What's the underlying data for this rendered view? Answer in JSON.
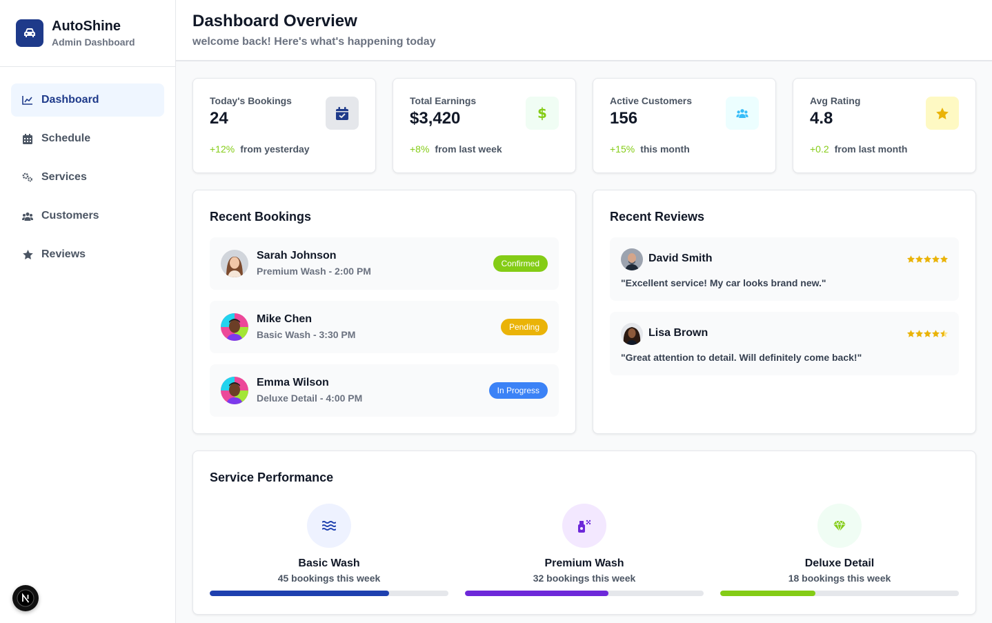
{
  "brand": {
    "name": "AutoShine",
    "subtitle": "Admin Dashboard"
  },
  "nav": [
    {
      "label": "Dashboard",
      "icon": "chart-line-icon",
      "active": true
    },
    {
      "label": "Schedule",
      "icon": "calendar-icon"
    },
    {
      "label": "Services",
      "icon": "gears-icon"
    },
    {
      "label": "Customers",
      "icon": "users-icon"
    },
    {
      "label": "Reviews",
      "icon": "star-icon"
    }
  ],
  "header": {
    "title": "Dashboard Overview",
    "subtitle": "welcome back! Here's what's happening today"
  },
  "stats": [
    {
      "label": "Today's Bookings",
      "value": "24",
      "delta": "+12%",
      "period": "from yesterday",
      "icon": "calendar-check-icon",
      "icon_color": "#1e3a8a",
      "icon_bg": "#e5e7eb"
    },
    {
      "label": "Total Earnings",
      "value": "$3,420",
      "delta": "+8%",
      "period": "from last week",
      "icon": "dollar-icon",
      "icon_color": "#84cc16",
      "icon_bg": "#f0fdf4"
    },
    {
      "label": "Active Customers",
      "value": "156",
      "delta": "+15%",
      "period": "this month",
      "icon": "users-icon",
      "icon_color": "#38bdf8",
      "icon_bg": "#ecfeff"
    },
    {
      "label": "Avg Rating",
      "value": "4.8",
      "delta": "+0.2",
      "period": "from last month",
      "icon": "star-icon",
      "icon_color": "#eab308",
      "icon_bg": "#fef9c3"
    }
  ],
  "recent_bookings": {
    "title": "Recent Bookings",
    "items": [
      {
        "name": "Sarah Johnson",
        "detail": "Premium Wash - 2:00 PM",
        "status": "Confirmed",
        "status_color": "#84cc16"
      },
      {
        "name": "Mike Chen",
        "detail": "Basic Wash - 3:30 PM",
        "status": "Pending",
        "status_color": "#eab308"
      },
      {
        "name": "Emma Wilson",
        "detail": "Deluxe Detail - 4:00 PM",
        "status": "In Progress",
        "status_color": "#3b82f6"
      }
    ]
  },
  "recent_reviews": {
    "title": "Recent Reviews",
    "items": [
      {
        "name": "David Smith",
        "text": "\"Excellent service! My car looks brand new.\"",
        "rating": 5
      },
      {
        "name": "Lisa Brown",
        "text": "\"Great attention to detail. Will definitely come back!\"",
        "rating": 4
      }
    ]
  },
  "service_performance": {
    "title": "Service Performance",
    "items": [
      {
        "name": "Basic Wash",
        "count": "45 bookings this week",
        "progress": 0.75,
        "color": "#1e40af",
        "icon": "water-waves-icon",
        "icon_bg": "#eef2ff"
      },
      {
        "name": "Premium Wash",
        "count": "32 bookings this week",
        "progress": 0.6,
        "color": "#6d28d9",
        "icon": "spray-bottle-icon",
        "icon_bg": "#f3e8ff"
      },
      {
        "name": "Deluxe Detail",
        "count": "18 bookings this week",
        "progress": 0.4,
        "color": "#84cc16",
        "icon": "gem-icon",
        "icon_bg": "#f0fdf4"
      }
    ]
  }
}
